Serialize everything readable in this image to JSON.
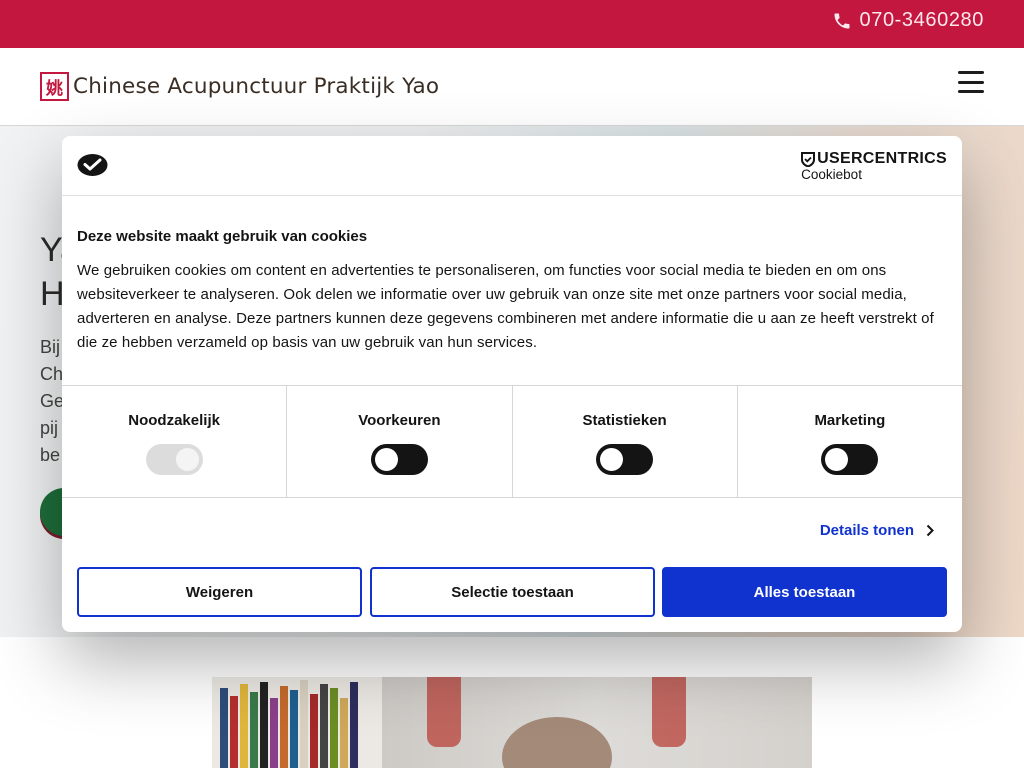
{
  "topbar": {
    "phone": "070-3460280"
  },
  "header": {
    "logo_mark": "姚",
    "logo_text": "Chinese Acupunctuur Praktijk Yao"
  },
  "hero": {
    "heading_line1": "Ya",
    "heading_line2": "H",
    "intro_lines": [
      "Bij",
      "Ch",
      "Ge",
      "pij",
      "be"
    ]
  },
  "cookie_dialog": {
    "brand_name": "USERCENTRICS",
    "brand_sub": "Cookiebot",
    "title": "Deze website maakt gebruik van cookies",
    "text": "We gebruiken cookies om content en advertenties te personaliseren, om functies voor social media te bieden en om ons websiteverkeer te analyseren. Ook delen we informatie over uw gebruik van onze site met onze partners voor social media, adverteren en analyse. Deze partners kunnen deze gegevens combineren met andere informatie die u aan ze heeft verstrekt of die ze hebben verzameld op basis van uw gebruik van hun services.",
    "categories": [
      {
        "label": "Noodzakelijk",
        "checked": true,
        "disabled": true
      },
      {
        "label": "Voorkeuren",
        "checked": false,
        "disabled": false
      },
      {
        "label": "Statistieken",
        "checked": false,
        "disabled": false
      },
      {
        "label": "Marketing",
        "checked": false,
        "disabled": false
      }
    ],
    "details_label": "Details tonen",
    "buttons": {
      "deny": "Weigeren",
      "selection": "Selectie toestaan",
      "allow_all": "Alles toestaan"
    }
  },
  "colors": {
    "brand_red": "#c4173f",
    "consent_blue": "#1032cf",
    "toggle_off": "#141414",
    "toggle_disabled": "#dcdcdc"
  },
  "icons": [
    "phone-icon",
    "hamburger-menu-icon",
    "cookie-icon",
    "usercentrics-shield-icon",
    "chevron-right-icon"
  ]
}
